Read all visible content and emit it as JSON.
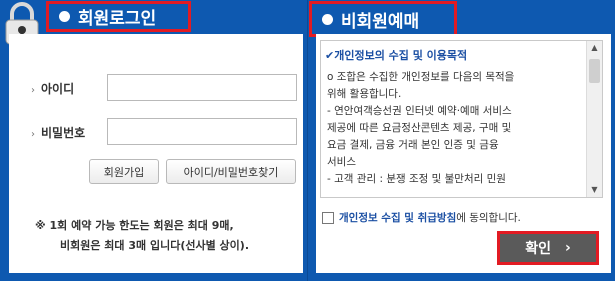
{
  "member": {
    "title": "회원로그인",
    "id_label": "아이디",
    "pw_label": "비밀번호",
    "id_value": "",
    "pw_value": "",
    "join_button": "회원가입",
    "find_button": "아이디/비밀번호찾기",
    "notice_line1": "※ 1회 예약 가능 한도는 회원은 최대 9매,",
    "notice_line2": "비회원은 최대 3매 입니다(선사별 상이)."
  },
  "guest": {
    "title": "비회원예매",
    "terms_title": "✔개인정보의 수집 및 이용목적",
    "terms_lines": [
      "o 조합은 수집한 개인정보를 다음의 목적을",
      "위해 활용합니다.",
      "- 연안여객승선권 인터넷 예약·예매 서비스",
      "제공에 따른 요금정산콘텐츠 제공, 구매 및",
      "요금 결제, 금융 거래 본인 인증 및 금융",
      "서비스",
      "- 고객 관리 : 분쟁 조정 및 불만처리 민원"
    ],
    "agree_link": "개인정보 수집 및 취급방침",
    "agree_rest": "에 동의합니다.",
    "confirm_label": "확인",
    "confirm_icon": "chevron-right-icon"
  },
  "colors": {
    "panel": "#0e59b0",
    "highlight": "#e21b23",
    "confirm_bg": "#5a5a5a"
  }
}
